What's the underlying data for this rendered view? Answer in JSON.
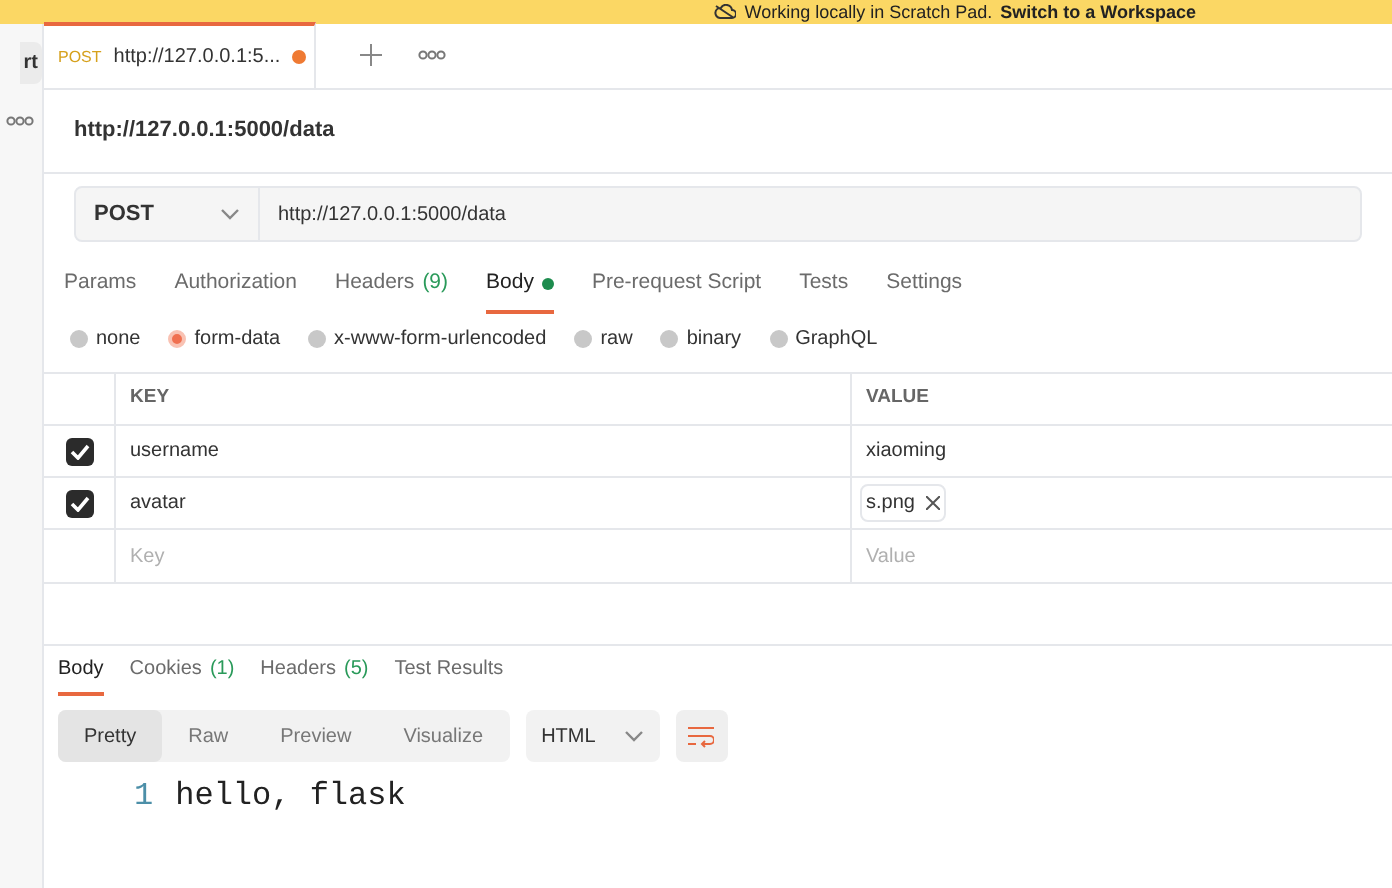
{
  "banner": {
    "text": "Working locally in Scratch Pad.",
    "link": "Switch to a Workspace"
  },
  "sidebar": {
    "button": "rt"
  },
  "tabs": [
    {
      "method": "POST",
      "label": "http://127.0.0.1:5...",
      "unsaved": true,
      "selected": true
    }
  ],
  "request_title": "http://127.0.0.1:5000/data",
  "request": {
    "method": "POST",
    "url": "http://127.0.0.1:5000/data"
  },
  "request_tabs": [
    {
      "label": "Params",
      "selected": false,
      "dot": false
    },
    {
      "label": "Authorization",
      "selected": false,
      "dot": false
    },
    {
      "label": "Headers",
      "count": "(9)",
      "selected": false,
      "dot": false
    },
    {
      "label": "Body",
      "selected": true,
      "dot": true
    },
    {
      "label": "Pre-request Script",
      "selected": false,
      "dot": false
    },
    {
      "label": "Tests",
      "selected": false,
      "dot": false
    },
    {
      "label": "Settings",
      "selected": false,
      "dot": false
    }
  ],
  "body_types": [
    {
      "label": "none",
      "selected": false
    },
    {
      "label": "form-data",
      "selected": true
    },
    {
      "label": "x-www-form-urlencoded",
      "selected": false
    },
    {
      "label": "raw",
      "selected": false
    },
    {
      "label": "binary",
      "selected": false
    },
    {
      "label": "GraphQL",
      "selected": false
    }
  ],
  "table": {
    "columns": [
      "KEY",
      "VALUE"
    ],
    "rows": [
      {
        "key": "username",
        "value": "xiaoming",
        "kind": "text",
        "checked": true
      },
      {
        "key": "avatar",
        "value": "s.png",
        "kind": "file",
        "checked": true
      }
    ],
    "new_row": {
      "key": {
        "placeholder": "Key"
      },
      "value": {
        "placeholder": "Value"
      }
    }
  },
  "response_tabs": [
    {
      "label": "Body",
      "selected": true
    },
    {
      "label": "Cookies",
      "count": "(1)",
      "selected": false
    },
    {
      "label": "Headers",
      "count": "(5)",
      "selected": false
    },
    {
      "label": "Test Results",
      "selected": false
    }
  ],
  "view_modes": [
    {
      "label": "Pretty",
      "selected": true
    },
    {
      "label": "Raw",
      "selected": false
    },
    {
      "label": "Preview",
      "selected": false
    },
    {
      "label": "Visualize",
      "selected": false
    }
  ],
  "format": "HTML",
  "code_lines": [
    {
      "number": "1",
      "text": "hello, flask"
    }
  ]
}
